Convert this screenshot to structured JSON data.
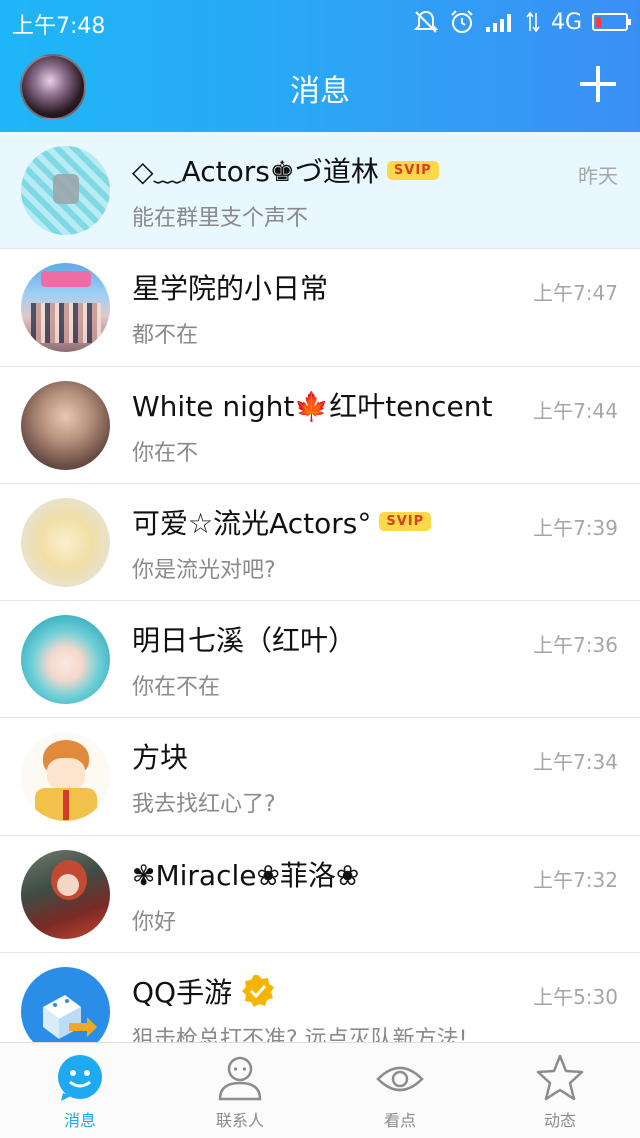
{
  "status": {
    "time": "上午7:48",
    "network": "4G"
  },
  "header": {
    "title": "消息"
  },
  "conversations": [
    {
      "name": "◇﹏Actors♚づ道林",
      "svip": "SVIP",
      "message": "能在群里支个声不",
      "time": "昨天",
      "pinned": true
    },
    {
      "name": "星学院的小日常",
      "message": "都不在",
      "time": "上午7:47"
    },
    {
      "name": "White night🍁红叶tencent",
      "message": "你在不",
      "time": "上午7:44"
    },
    {
      "name": "可爱☆流光Actors°",
      "svip": "SVIP",
      "message": "你是流光对吧?",
      "time": "上午7:39"
    },
    {
      "name": "明日七溪（红叶）",
      "message": "你在不在",
      "time": "上午7:36"
    },
    {
      "name": "方块",
      "message": "我去找红心了?",
      "time": "上午7:34"
    },
    {
      "name": "✾Miracle❀菲洛❀",
      "message": "你好",
      "time": "上午7:32"
    },
    {
      "name": "QQ手游",
      "message": "狙击枪总打不准? 远点灭队新方法!",
      "time": "上午5:30"
    }
  ],
  "tabs": [
    {
      "label": "消息",
      "icon": "chat-bubble-icon",
      "active": true
    },
    {
      "label": "联系人",
      "icon": "contacts-icon"
    },
    {
      "label": "看点",
      "icon": "eye-icon"
    },
    {
      "label": "动态",
      "icon": "star-icon"
    }
  ],
  "colors": {
    "accent": "#1eaaf1",
    "svip_bg": "#ffd84a",
    "svip_text": "#d4411f",
    "pinned_bg": "#e9f8fe"
  }
}
